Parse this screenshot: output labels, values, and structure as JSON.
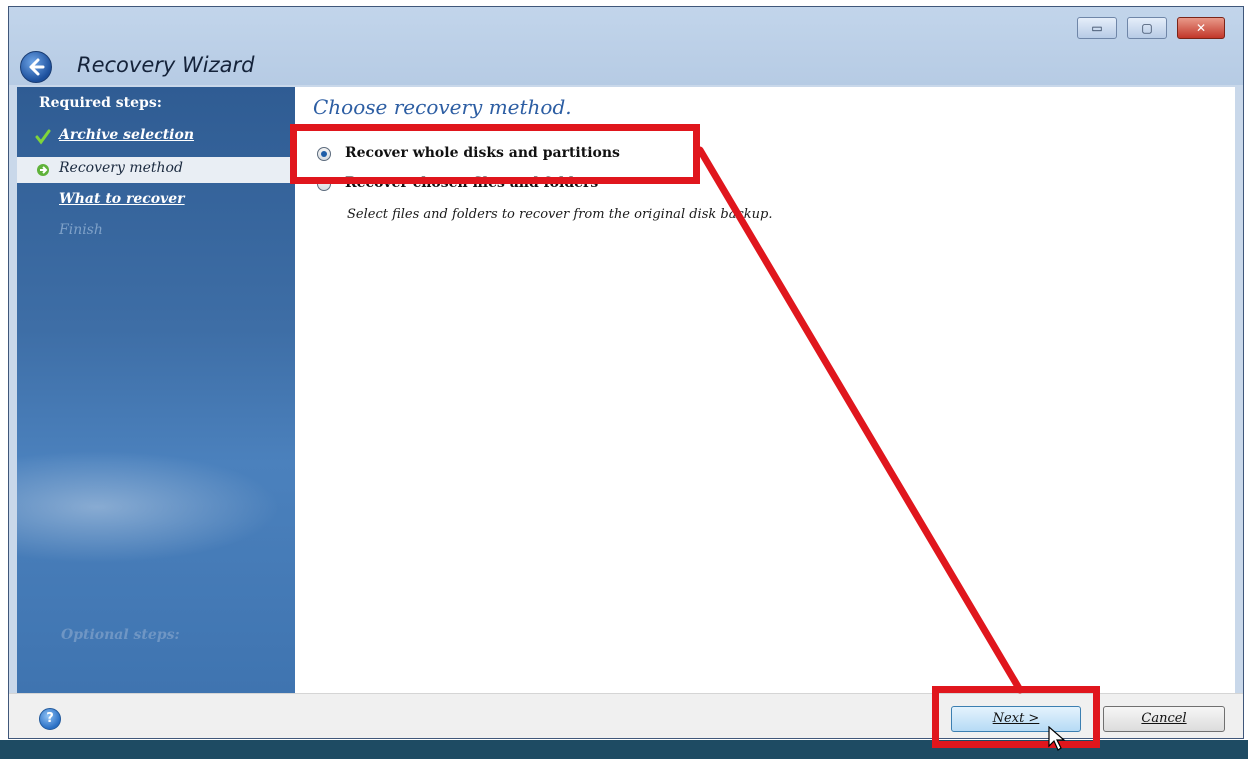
{
  "window": {
    "title": "Recovery Wizard",
    "controls": {
      "minimize": "▭",
      "maximize": "▢",
      "close": "✕"
    }
  },
  "sidebar": {
    "heading": "Required steps:",
    "steps": [
      {
        "label": "Archive selection",
        "state": "done"
      },
      {
        "label": "Recovery method",
        "state": "current"
      },
      {
        "label": "What to recover",
        "state": "link"
      },
      {
        "label": "Finish",
        "state": "disabled"
      }
    ],
    "optional_heading": "Optional steps:"
  },
  "content": {
    "heading": "Choose recovery method.",
    "options": [
      {
        "label": "Recover whole disks and partitions",
        "selected": true
      },
      {
        "label": "Recover chosen files and folders",
        "selected": false
      }
    ],
    "description": "Select files and folders to recover from the original disk backup."
  },
  "footer": {
    "help_icon": "?",
    "next_label": "Next >",
    "cancel_label": "Cancel"
  },
  "annotation": {
    "highlight_color": "#e0161d"
  }
}
